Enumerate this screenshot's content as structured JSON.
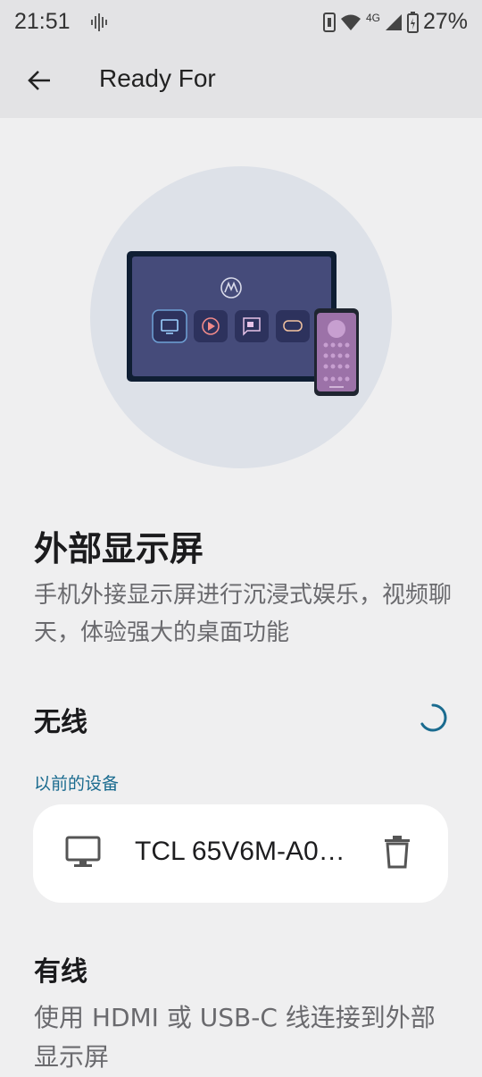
{
  "status_bar": {
    "time": "21:51",
    "network": "4G",
    "battery": "27%"
  },
  "app_bar": {
    "title": "Ready For",
    "back_icon": "arrow-left-icon"
  },
  "hero": {
    "illustration": "tv-and-phone-illustration"
  },
  "external_display": {
    "title": "外部显示屏",
    "description": "手机外接显示屏进行沉浸式娱乐，视频聊天，体验强大的桌面功能"
  },
  "wireless": {
    "title": "无线",
    "previous_label": "以前的设备",
    "devices": [
      {
        "name": "TCL 65V6M-A0…",
        "icon": "monitor-icon",
        "action_icon": "trash-icon"
      }
    ]
  },
  "wired": {
    "title": "有线",
    "description": "使用 HDMI 或 USB-C 线连接到外部显示屏"
  },
  "colors": {
    "background": "#efeff0",
    "app_bar": "#e3e3e5",
    "accent": "#1a6b8f",
    "card": "#ffffff"
  }
}
